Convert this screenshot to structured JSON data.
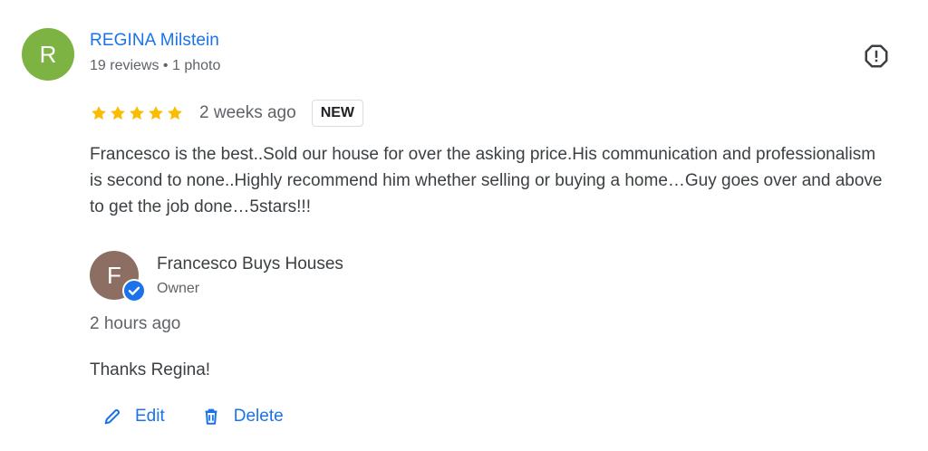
{
  "reviewer": {
    "initial": "R",
    "name": "REGINA Milstein",
    "meta": "19 reviews • 1 photo",
    "avatar_color": "#7cb342"
  },
  "review": {
    "rating": 5,
    "max_rating": 5,
    "time": "2 weeks ago",
    "badge": "NEW",
    "text": "Francesco is the best..Sold our house for over the asking price.His communication and professionalism is second to none..Highly recommend him whether selling or buying a home…Guy goes over and above to get the job done…5stars!!!"
  },
  "reply": {
    "owner_initial": "F",
    "owner_name": "Francesco Buys Houses",
    "owner_role": "Owner",
    "time": "2 hours ago",
    "text": "Thanks Regina!",
    "avatar_color": "#8d6e63"
  },
  "actions": {
    "edit_label": "Edit",
    "delete_label": "Delete"
  },
  "icons": {
    "flag": "report-icon",
    "star": "star-icon",
    "verified": "verified-icon",
    "edit": "pencil-icon",
    "delete": "trash-icon"
  },
  "colors": {
    "accent": "#1a73e8",
    "star": "#fbbc04"
  }
}
